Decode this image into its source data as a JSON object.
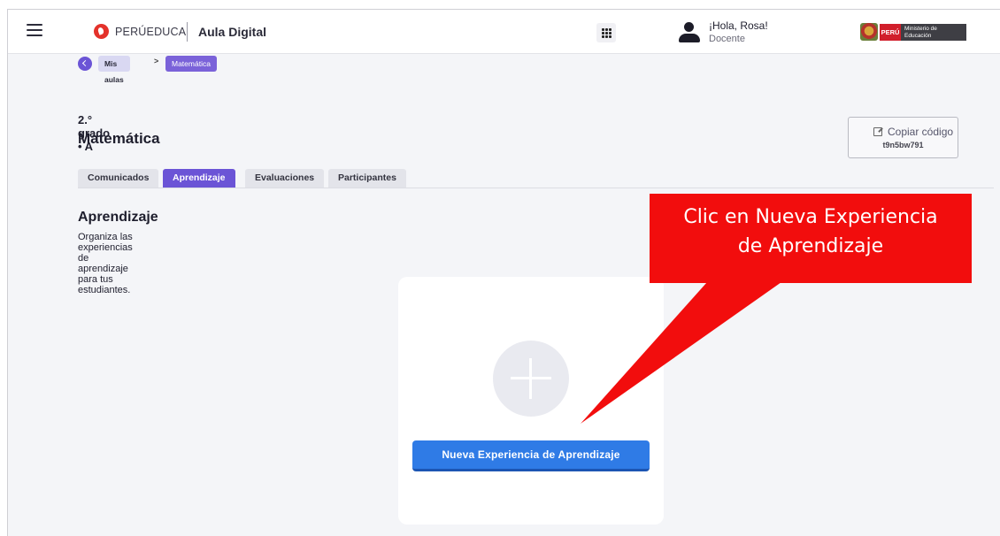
{
  "header": {
    "brand": "PERÚEDUCA",
    "app_name": "Aula Digital",
    "user_greeting": "¡Hola, Rosa!",
    "user_role": "Docente",
    "ministry_country": "PERÚ",
    "ministry_name": "Ministerio de Educación"
  },
  "breadcrumb": {
    "items": [
      "Mis aulas",
      "Matemática"
    ],
    "separator": ">"
  },
  "classroom": {
    "grade": "2.° grado • A",
    "course": "Matemática",
    "copy_label": "Copiar código",
    "code": "t9n5bw791"
  },
  "tabs": [
    {
      "label": "Comunicados",
      "active": false
    },
    {
      "label": "Aprendizaje",
      "active": true
    },
    {
      "label": "Evaluaciones",
      "active": false
    },
    {
      "label": "Participantes",
      "active": false
    }
  ],
  "section": {
    "title": "Aprendizaje",
    "subtitle": "Organiza las experiencias de aprendizaje para tus estudiantes."
  },
  "card": {
    "button_label": "Nueva Experiencia de Aprendizaje"
  },
  "annotation": {
    "line1": "Clic en Nueva Experiencia",
    "line2": "de Aprendizaje"
  },
  "colors": {
    "accent": "#6b54d6",
    "primary_button": "#2f7be6",
    "annotation": "#f20d0d"
  }
}
